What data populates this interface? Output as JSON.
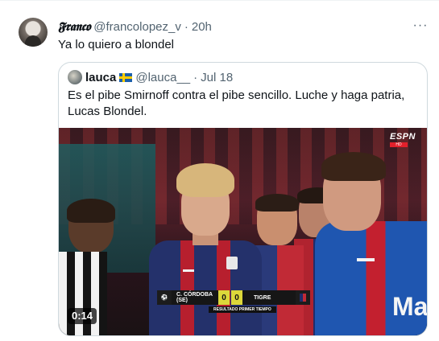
{
  "tweet": {
    "display_name": "𝕱𝖗𝖆𝖓𝖈𝖔",
    "handle": "@francolopez_v",
    "separator": "·",
    "time": "20h",
    "text": "Ya lo quiero a blondel",
    "more_icon": "more-horizontal-icon",
    "more_glyph": "···"
  },
  "quote": {
    "display_name": "lauca",
    "flag": "sweden-flag",
    "handle": "@lauca__",
    "separator": "·",
    "time": "Jul 18",
    "text": "Es el pibe Smirnoff contra el pibe sencillo. Luche y haga patria, Lucas Blondel.",
    "media": {
      "duration": "0:14",
      "broadcaster": "ESPN",
      "broadcaster_sub": "HD",
      "scoreboard": {
        "team_home": "C. CÓRDOBA (SE)",
        "score_home": "0",
        "score_away": "0",
        "team_away": "TIGRE",
        "caption": "RESULTADO PRIMER TIEMPO"
      },
      "sponsor_text": "Ma",
      "colors": {
        "tigre_blue": "#1f56b0",
        "tigre_red": "#c3202f",
        "score_yellow": "#dcd83a"
      }
    }
  }
}
